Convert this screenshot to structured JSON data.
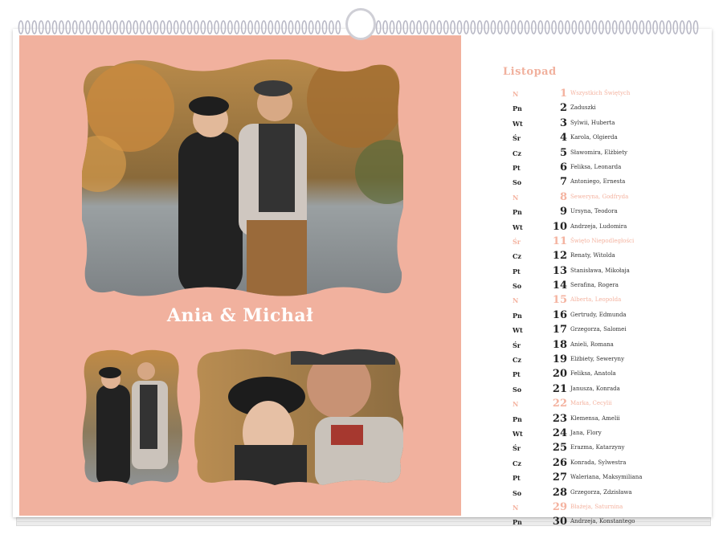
{
  "couple_title": "Ania & Michał",
  "calendar": {
    "month": "Listopad",
    "accent_color": "#f1b19e",
    "days": [
      {
        "dow": "N",
        "day": "1",
        "name": "Wszystkich Świętych",
        "sunday": true
      },
      {
        "dow": "Pn",
        "day": "2",
        "name": "Zaduszki",
        "sunday": false
      },
      {
        "dow": "Wt",
        "day": "3",
        "name": "Sylwii, Huberta",
        "sunday": false
      },
      {
        "dow": "Śr",
        "day": "4",
        "name": "Karola, Olgierda",
        "sunday": false
      },
      {
        "dow": "Cz",
        "day": "5",
        "name": "Sławomira, Elżbiety",
        "sunday": false
      },
      {
        "dow": "Pt",
        "day": "6",
        "name": "Feliksa, Leonarda",
        "sunday": false
      },
      {
        "dow": "So",
        "day": "7",
        "name": "Antoniego, Ernesta",
        "sunday": false
      },
      {
        "dow": "N",
        "day": "8",
        "name": "Seweryna, Godfryda",
        "sunday": true
      },
      {
        "dow": "Pn",
        "day": "9",
        "name": "Ursyna, Teodora",
        "sunday": false
      },
      {
        "dow": "Wt",
        "day": "10",
        "name": "Andrzeja, Ludomira",
        "sunday": false
      },
      {
        "dow": "Śr",
        "day": "11",
        "name": "Święto Niepodległości",
        "sunday": true
      },
      {
        "dow": "Cz",
        "day": "12",
        "name": "Renaty, Witolda",
        "sunday": false
      },
      {
        "dow": "Pt",
        "day": "13",
        "name": "Stanisława, Mikołaja",
        "sunday": false
      },
      {
        "dow": "So",
        "day": "14",
        "name": "Serafina, Rogera",
        "sunday": false
      },
      {
        "dow": "N",
        "day": "15",
        "name": "Alberta, Leopolda",
        "sunday": true
      },
      {
        "dow": "Pn",
        "day": "16",
        "name": "Gertrudy, Edmunda",
        "sunday": false
      },
      {
        "dow": "Wt",
        "day": "17",
        "name": "Grzegorza, Salomei",
        "sunday": false
      },
      {
        "dow": "Śr",
        "day": "18",
        "name": "Anieli, Romana",
        "sunday": false
      },
      {
        "dow": "Cz",
        "day": "19",
        "name": "Elżbiety, Seweryny",
        "sunday": false
      },
      {
        "dow": "Pt",
        "day": "20",
        "name": "Feliksa, Anatola",
        "sunday": false
      },
      {
        "dow": "So",
        "day": "21",
        "name": "Janusza, Konrada",
        "sunday": false
      },
      {
        "dow": "N",
        "day": "22",
        "name": "Marka, Cecylii",
        "sunday": true
      },
      {
        "dow": "Pn",
        "day": "23",
        "name": "Klemensa, Amelii",
        "sunday": false
      },
      {
        "dow": "Wt",
        "day": "24",
        "name": "Jana, Flory",
        "sunday": false
      },
      {
        "dow": "Śr",
        "day": "25",
        "name": "Erazma, Katarzyny",
        "sunday": false
      },
      {
        "dow": "Cz",
        "day": "26",
        "name": "Konrada, Sylwestra",
        "sunday": false
      },
      {
        "dow": "Pt",
        "day": "27",
        "name": "Waleriana, Maksymiliana",
        "sunday": false
      },
      {
        "dow": "So",
        "day": "28",
        "name": "Grzegorza, Zdzisława",
        "sunday": false
      },
      {
        "dow": "N",
        "day": "29",
        "name": "Błażeja, Saturnina",
        "sunday": true
      },
      {
        "dow": "Pn",
        "day": "30",
        "name": "Andrzeja, Konstantego",
        "sunday": false
      }
    ]
  }
}
